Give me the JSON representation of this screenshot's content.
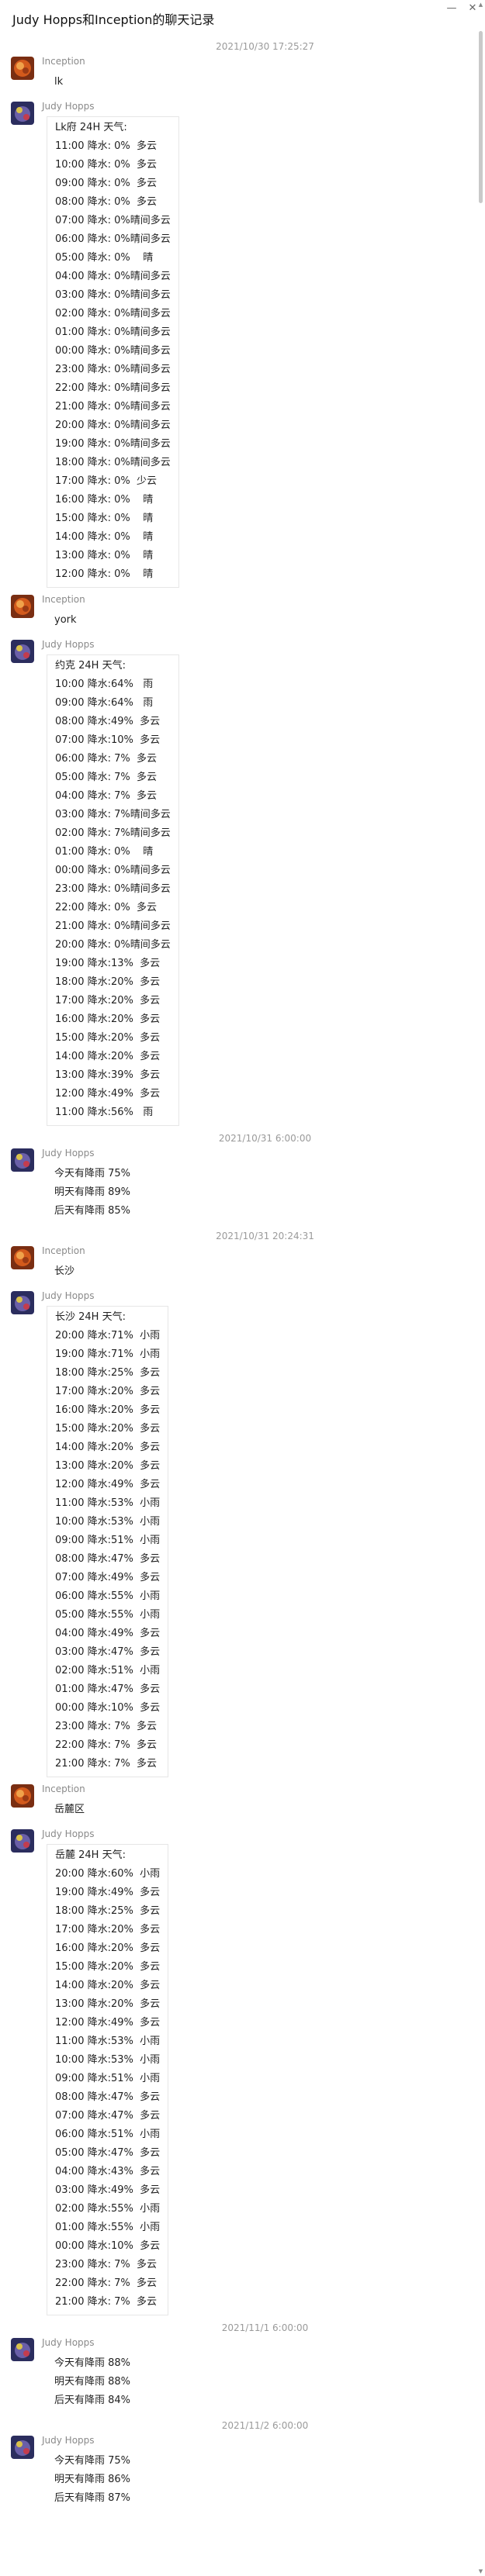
{
  "window": {
    "title": "Judy Hopps和Inception的聊天记录",
    "minimize_glyph": "—",
    "close_glyph": "✕"
  },
  "messages": [
    {
      "timestamp": "2021/10/30 17:25:27"
    },
    {
      "sender": "Inception",
      "avatar": "inception-avatar",
      "text": [
        "lk"
      ]
    },
    {
      "sender": "Judy Hopps",
      "avatar": "judy-avatar",
      "boxed": true,
      "text": [
        "Lk府 24H 天气:",
        "11:00 降水: 0%  多云",
        "10:00 降水: 0%  多云",
        "09:00 降水: 0%  多云",
        "08:00 降水: 0%  多云",
        "07:00 降水: 0%晴间多云",
        "06:00 降水: 0%晴间多云",
        "05:00 降水: 0%    晴",
        "04:00 降水: 0%晴间多云",
        "03:00 降水: 0%晴间多云",
        "02:00 降水: 0%晴间多云",
        "01:00 降水: 0%晴间多云",
        "00:00 降水: 0%晴间多云",
        "23:00 降水: 0%晴间多云",
        "22:00 降水: 0%晴间多云",
        "21:00 降水: 0%晴间多云",
        "20:00 降水: 0%晴间多云",
        "19:00 降水: 0%晴间多云",
        "18:00 降水: 0%晴间多云",
        "17:00 降水: 0%  少云",
        "16:00 降水: 0%    晴",
        "15:00 降水: 0%    晴",
        "14:00 降水: 0%    晴",
        "13:00 降水: 0%    晴",
        "12:00 降水: 0%    晴"
      ]
    },
    {
      "sender": "Inception",
      "avatar": "inception-avatar",
      "text": [
        "york"
      ]
    },
    {
      "sender": "Judy Hopps",
      "avatar": "judy-avatar",
      "boxed": true,
      "text": [
        "约克 24H 天气:",
        "10:00 降水:64%   雨",
        "09:00 降水:64%   雨",
        "08:00 降水:49%  多云",
        "07:00 降水:10%  多云",
        "06:00 降水: 7%  多云",
        "05:00 降水: 7%  多云",
        "04:00 降水: 7%  多云",
        "03:00 降水: 7%晴间多云",
        "02:00 降水: 7%晴间多云",
        "01:00 降水: 0%    晴",
        "00:00 降水: 0%晴间多云",
        "23:00 降水: 0%晴间多云",
        "22:00 降水: 0%  多云",
        "21:00 降水: 0%晴间多云",
        "20:00 降水: 0%晴间多云",
        "19:00 降水:13%  多云",
        "18:00 降水:20%  多云",
        "17:00 降水:20%  多云",
        "16:00 降水:20%  多云",
        "15:00 降水:20%  多云",
        "14:00 降水:20%  多云",
        "13:00 降水:39%  多云",
        "12:00 降水:49%  多云",
        "11:00 降水:56%   雨"
      ]
    },
    {
      "timestamp": "2021/10/31 6:00:00"
    },
    {
      "sender": "Judy Hopps",
      "avatar": "judy-avatar",
      "text": [
        "今天有降雨 75%",
        "明天有降雨 89%",
        "后天有降雨 85%"
      ]
    },
    {
      "timestamp": "2021/10/31 20:24:31"
    },
    {
      "sender": "Inception",
      "avatar": "inception-avatar",
      "text": [
        "长沙"
      ]
    },
    {
      "sender": "Judy Hopps",
      "avatar": "judy-avatar",
      "boxed": true,
      "text": [
        "长沙 24H 天气:",
        "20:00 降水:71%  小雨",
        "19:00 降水:71%  小雨",
        "18:00 降水:25%  多云",
        "17:00 降水:20%  多云",
        "16:00 降水:20%  多云",
        "15:00 降水:20%  多云",
        "14:00 降水:20%  多云",
        "13:00 降水:20%  多云",
        "12:00 降水:49%  多云",
        "11:00 降水:53%  小雨",
        "10:00 降水:53%  小雨",
        "09:00 降水:51%  小雨",
        "08:00 降水:47%  多云",
        "07:00 降水:49%  多云",
        "06:00 降水:55%  小雨",
        "05:00 降水:55%  小雨",
        "04:00 降水:49%  多云",
        "03:00 降水:47%  多云",
        "02:00 降水:51%  小雨",
        "01:00 降水:47%  多云",
        "00:00 降水:10%  多云",
        "23:00 降水: 7%  多云",
        "22:00 降水: 7%  多云",
        "21:00 降水: 7%  多云"
      ]
    },
    {
      "sender": "Inception",
      "avatar": "inception-avatar",
      "text": [
        "岳麓区"
      ]
    },
    {
      "sender": "Judy Hopps",
      "avatar": "judy-avatar",
      "boxed": true,
      "text": [
        "岳麓 24H 天气:",
        "20:00 降水:60%  小雨",
        "19:00 降水:49%  多云",
        "18:00 降水:25%  多云",
        "17:00 降水:20%  多云",
        "16:00 降水:20%  多云",
        "15:00 降水:20%  多云",
        "14:00 降水:20%  多云",
        "13:00 降水:20%  多云",
        "12:00 降水:49%  多云",
        "11:00 降水:53%  小雨",
        "10:00 降水:53%  小雨",
        "09:00 降水:51%  小雨",
        "08:00 降水:47%  多云",
        "07:00 降水:47%  多云",
        "06:00 降水:51%  小雨",
        "05:00 降水:47%  多云",
        "04:00 降水:43%  多云",
        "03:00 降水:49%  多云",
        "02:00 降水:55%  小雨",
        "01:00 降水:55%  小雨",
        "00:00 降水:10%  多云",
        "23:00 降水: 7%  多云",
        "22:00 降水: 7%  多云",
        "21:00 降水: 7%  多云"
      ]
    },
    {
      "timestamp": "2021/11/1 6:00:00"
    },
    {
      "sender": "Judy Hopps",
      "avatar": "judy-avatar",
      "text": [
        "今天有降雨 88%",
        "明天有降雨 88%",
        "后天有降雨 84%"
      ]
    },
    {
      "timestamp": "2021/11/2 6:00:00"
    },
    {
      "sender": "Judy Hopps",
      "avatar": "judy-avatar",
      "text": [
        "今天有降雨 75%",
        "明天有降雨 86%",
        "后天有降雨 87%"
      ]
    }
  ]
}
